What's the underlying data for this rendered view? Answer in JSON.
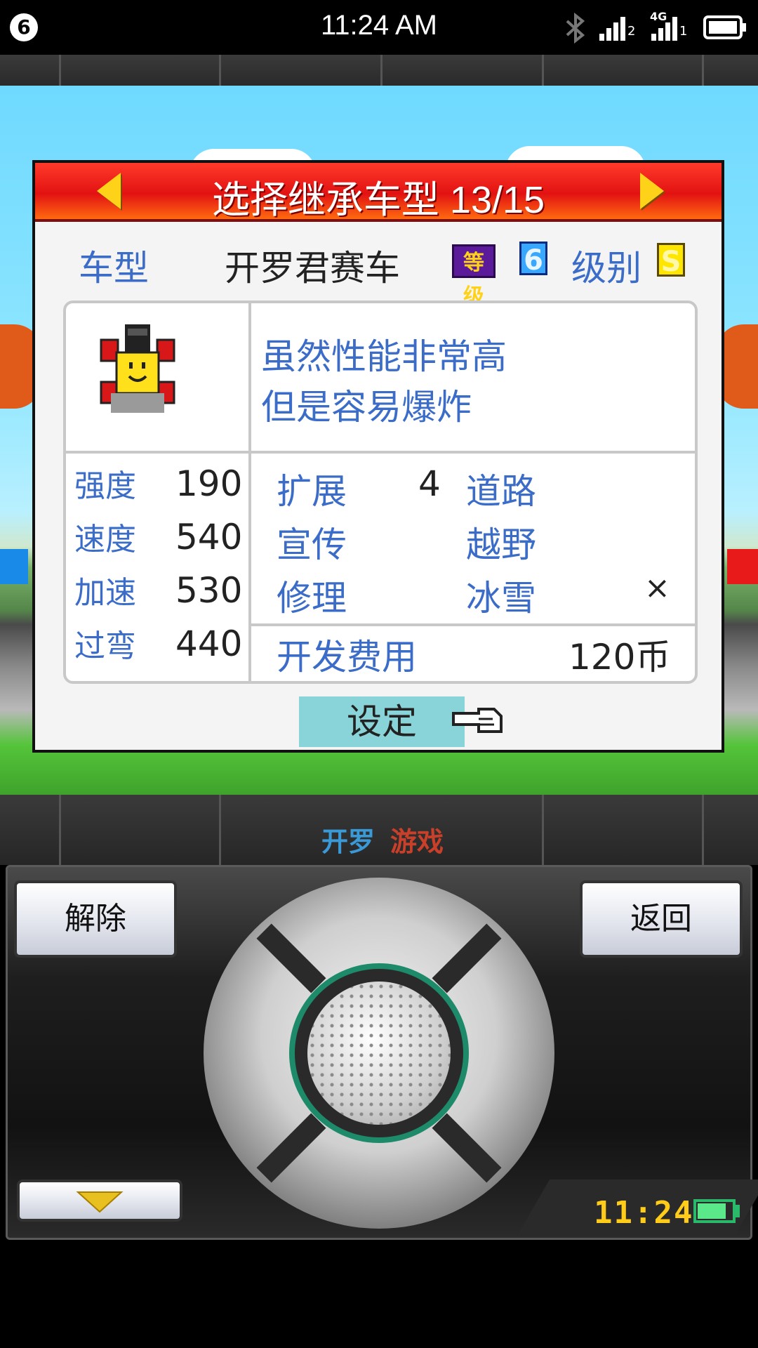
{
  "status_bar": {
    "notification_count": "6",
    "time": "11:24 AM",
    "network_label": "4G",
    "sim1": "2",
    "sim2": "1"
  },
  "dialog": {
    "title": "选择继承车型 13/15",
    "car_type_label": "车型",
    "car_name": "开罗君赛车",
    "rank_label": "等级",
    "rank_value": "6",
    "class_label": "级别",
    "class_value": "S",
    "description_line1": "虽然性能非常高",
    "description_line2": "但是容易爆炸",
    "stats": [
      {
        "label": "强度",
        "value": "190"
      },
      {
        "label": "速度",
        "value": "540"
      },
      {
        "label": "加速",
        "value": "530"
      },
      {
        "label": "过弯",
        "value": "440"
      }
    ],
    "attributes": {
      "expand_label": "扩展",
      "expand_value": "4",
      "promo_label": "宣传",
      "promo_value": "",
      "repair_label": "修理",
      "repair_value": "",
      "road_label": "道路",
      "road_value": "",
      "offroad_label": "越野",
      "offroad_value": "",
      "snow_label": "冰雪",
      "snow_value": "×"
    },
    "dev_cost_label": "开发费用",
    "dev_cost_value": "120币",
    "set_button": "设定"
  },
  "branding": {
    "logo_part1": "开罗",
    "logo_part2": "游戏"
  },
  "controller": {
    "left_softkey": "解除",
    "right_softkey": "返回",
    "game_clock": "11:24"
  },
  "colors": {
    "header_red": "#e21212",
    "accent_blue": "#3a6cc8",
    "button_teal": "#88d4d8",
    "clock_yellow": "#ffcc1a"
  }
}
